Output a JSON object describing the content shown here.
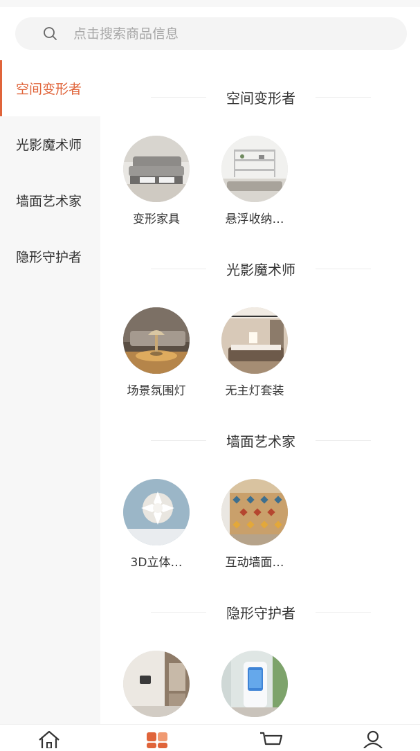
{
  "search": {
    "placeholder": "点击搜索商品信息",
    "icon": "search-icon"
  },
  "sidebar": {
    "items": [
      {
        "label": "空间变形者",
        "active": true
      },
      {
        "label": "光影魔术师",
        "active": false
      },
      {
        "label": "墙面艺术家",
        "active": false
      },
      {
        "label": "隐形守护者",
        "active": false
      }
    ]
  },
  "sections": [
    {
      "title": "空间变形者",
      "products": [
        {
          "name": "变形家具"
        },
        {
          "name": "悬浮收纳…"
        }
      ]
    },
    {
      "title": "光影魔术师",
      "products": [
        {
          "name": "场景氛围灯"
        },
        {
          "name": "无主灯套装"
        }
      ]
    },
    {
      "title": "墙面艺术家",
      "products": [
        {
          "name": "3D立体…"
        },
        {
          "name": "互动墙面…"
        }
      ]
    },
    {
      "title": "隐形守护者",
      "products": [
        {
          "name": ""
        },
        {
          "name": ""
        }
      ]
    }
  ],
  "tabbar": {
    "tabs": [
      {
        "icon": "home-icon"
      },
      {
        "icon": "category-icon",
        "active": true
      },
      {
        "icon": "cart-icon"
      },
      {
        "icon": "user-icon"
      }
    ],
    "accent": "#e0643a"
  },
  "colors": {
    "accent": "#e0643a",
    "sidebar_bg": "#f7f7f7"
  }
}
